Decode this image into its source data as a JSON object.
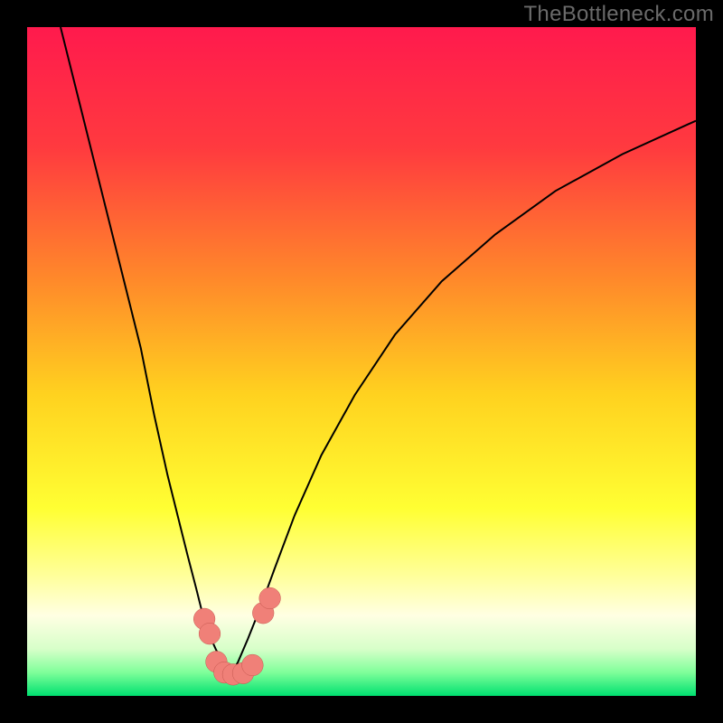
{
  "watermark": "TheBottleneck.com",
  "chart_data": {
    "type": "line",
    "title": "",
    "xlabel": "",
    "ylabel": "",
    "xlim": [
      0,
      100
    ],
    "ylim": [
      0,
      100
    ],
    "grid": false,
    "background_gradient": {
      "stops": [
        {
          "offset": 0.0,
          "color": "#ff1a4d"
        },
        {
          "offset": 0.18,
          "color": "#ff3a3f"
        },
        {
          "offset": 0.38,
          "color": "#ff8a2a"
        },
        {
          "offset": 0.55,
          "color": "#ffd21f"
        },
        {
          "offset": 0.72,
          "color": "#ffff33"
        },
        {
          "offset": 0.82,
          "color": "#ffff9a"
        },
        {
          "offset": 0.88,
          "color": "#ffffe3"
        },
        {
          "offset": 0.93,
          "color": "#d7ffc9"
        },
        {
          "offset": 0.965,
          "color": "#7fff9a"
        },
        {
          "offset": 1.0,
          "color": "#00e070"
        }
      ]
    },
    "series": [
      {
        "name": "left-branch",
        "color": "#000000",
        "x": [
          5,
          8,
          11,
          14,
          17,
          19,
          21,
          22.5,
          24,
          25.3,
          26.3,
          27.3,
          28.2,
          29.0,
          29.7,
          30.3
        ],
        "y": [
          100,
          88,
          76,
          64,
          52,
          42,
          33,
          27,
          21,
          16,
          12,
          9,
          7,
          5.5,
          4,
          3
        ]
      },
      {
        "name": "right-branch",
        "color": "#000000",
        "x": [
          30.3,
          31.5,
          33,
          34.8,
          37,
          40,
          44,
          49,
          55,
          62,
          70,
          79,
          89,
          100
        ],
        "y": [
          3,
          5,
          8.5,
          13,
          19,
          27,
          36,
          45,
          54,
          62,
          69,
          75.5,
          81,
          86
        ]
      }
    ],
    "markers": [
      {
        "name": "marker-a",
        "x": 26.5,
        "y": 11.5,
        "r": 1.6
      },
      {
        "name": "marker-b",
        "x": 27.3,
        "y": 9.3,
        "r": 1.6
      },
      {
        "name": "marker-c",
        "x": 28.3,
        "y": 5.1,
        "r": 1.6
      },
      {
        "name": "marker-d",
        "x": 29.5,
        "y": 3.5,
        "r": 1.6
      },
      {
        "name": "marker-e",
        "x": 30.8,
        "y": 3.2,
        "r": 1.6
      },
      {
        "name": "marker-f",
        "x": 32.3,
        "y": 3.4,
        "r": 1.6
      },
      {
        "name": "marker-g",
        "x": 33.7,
        "y": 4.6,
        "r": 1.6
      },
      {
        "name": "marker-h",
        "x": 35.3,
        "y": 12.4,
        "r": 1.6
      },
      {
        "name": "marker-i",
        "x": 36.3,
        "y": 14.6,
        "r": 1.6
      }
    ],
    "marker_style": {
      "fill": "#f08078",
      "stroke": "#c4564e",
      "stroke_width": 0.5
    }
  }
}
